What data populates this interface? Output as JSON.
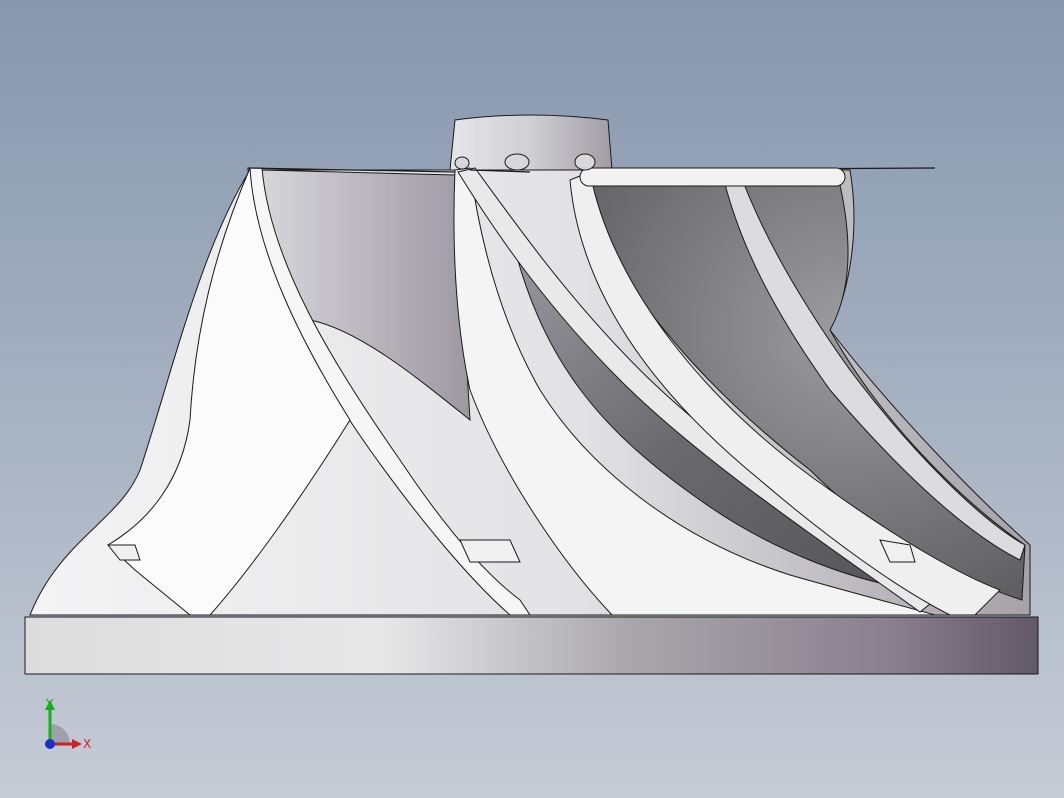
{
  "viewport": {
    "background_top": "#8797ae",
    "background_bottom": "#c6ccd6"
  },
  "model": {
    "body_light": "#f2f2f3",
    "body_dark": "#6a6070",
    "blade_dark": "#5e5e60",
    "edge_color": "#1a1a1a"
  },
  "triad": {
    "x_label": "X",
    "y_label": "Y",
    "x_color": "#d02020",
    "y_color": "#18b018",
    "z_color": "#1830c8"
  }
}
